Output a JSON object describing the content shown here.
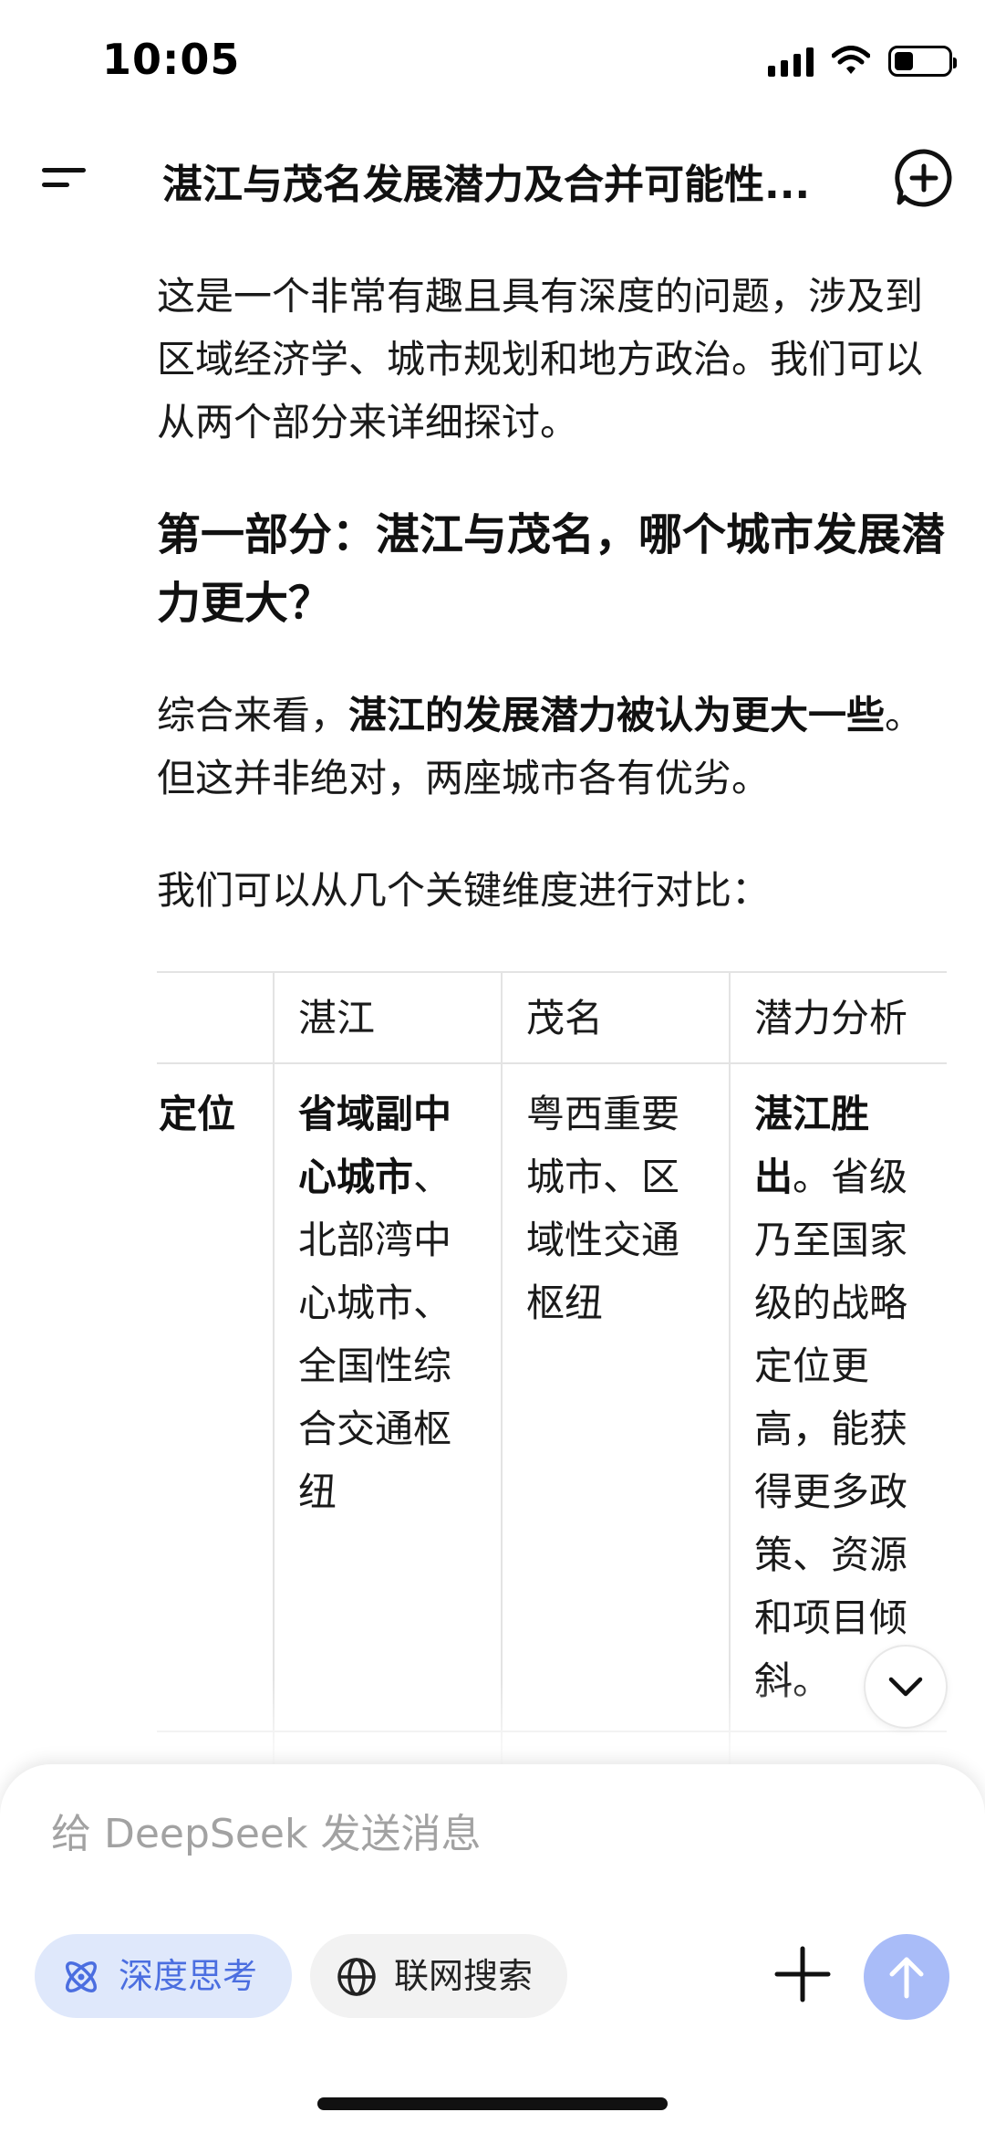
{
  "status_bar": {
    "time": "10:05"
  },
  "header": {
    "title": "湛江与茂名发展潜力及合并可能性..."
  },
  "content": {
    "intro": "这是一个非常有趣且具有深度的问题，涉及到区域经济学、城市规划和地方政治。我们可以从两个部分来详细探讨。",
    "heading": "第一部分：湛江与茂名，哪个城市发展潜力更大？",
    "summary_prefix": "综合来看，",
    "summary_bold": "湛江的发展潜力被认为更大一些",
    "summary_suffix": "。但这并非绝对，两座城市各有优劣。",
    "compare_intro": "我们可以从几个关键维度进行对比："
  },
  "table": {
    "headers": [
      "",
      "湛江",
      "茂名",
      "潜力分析"
    ],
    "rows": [
      {
        "label": "定位",
        "zhanjiang_bold": "省域副中心城市",
        "zhanjiang_rest": "、北部湾中心城市、全国性综合交通枢纽",
        "maoming": "粤西重要城市、区域性交通枢纽",
        "analysis_bold": "湛江胜出",
        "analysis_rest": "。省级乃至国家级的战略定位更高，能获得更多政策、资源和项目倾斜。"
      }
    ]
  },
  "input": {
    "placeholder": "给 DeepSeek 发送消息",
    "deep_think_label": "深度思考",
    "web_search_label": "联网搜索"
  },
  "colors": {
    "accent": "#4b6ee0",
    "accent_bg": "#dfe8fb",
    "send_button": "#a9bcf8"
  }
}
